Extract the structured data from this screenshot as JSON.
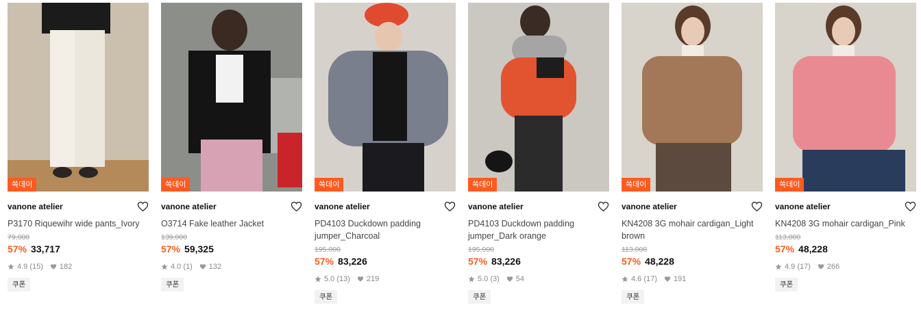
{
  "products": [
    {
      "badge": "쓱데이",
      "brand": "vanone atelier",
      "name": "P3170 Riquewihr wide pants_Ivory",
      "original_price": "79,000",
      "discount": "57%",
      "price": "33,717",
      "rating": "4.9 (15)",
      "likes": "182",
      "coupon": "쿠폰",
      "bg": "#cbbfae"
    },
    {
      "badge": "쓱데이",
      "brand": "vanone atelier",
      "name": "O3714 Fake leather Jacket",
      "original_price": "139,000",
      "discount": "57%",
      "price": "59,325",
      "rating": "4.0 (1)",
      "likes": "132",
      "coupon": "쿠폰",
      "bg": "#a7a9a4"
    },
    {
      "badge": "쓱데이",
      "brand": "vanone atelier",
      "name": "PD4103 Duckdown padding jumper_Charcoal",
      "original_price": "195,000",
      "discount": "57%",
      "price": "83,226",
      "rating": "5.0 (13)",
      "likes": "219",
      "coupon": "쿠폰",
      "bg": "#d6d1ca"
    },
    {
      "badge": "쓱데이",
      "brand": "vanone atelier",
      "name": "PD4103 Duckdown padding jumper_Dark orange",
      "original_price": "195,000",
      "discount": "57%",
      "price": "83,226",
      "rating": "5.0 (3)",
      "likes": "54",
      "coupon": "쿠폰",
      "bg": "#cbc7c1"
    },
    {
      "badge": "쓱데이",
      "brand": "vanone atelier",
      "name": "KN4208 3G mohair cardigan_Light brown",
      "original_price": "113,000",
      "discount": "57%",
      "price": "48,228",
      "rating": "4.6 (17)",
      "likes": "191",
      "coupon": "쿠폰",
      "bg": "#d8d3cb"
    },
    {
      "badge": "쓱데이",
      "brand": "vanone atelier",
      "name": "KN4208 3G mohair cardigan_Pink",
      "original_price": "113,000",
      "discount": "57%",
      "price": "48,228",
      "rating": "4.9 (17)",
      "likes": "266",
      "coupon": "쿠폰",
      "bg": "#d8d3cb"
    }
  ],
  "colors": {
    "accent": "#ff5a1f",
    "coupon_bg": "#f2f2f2"
  }
}
